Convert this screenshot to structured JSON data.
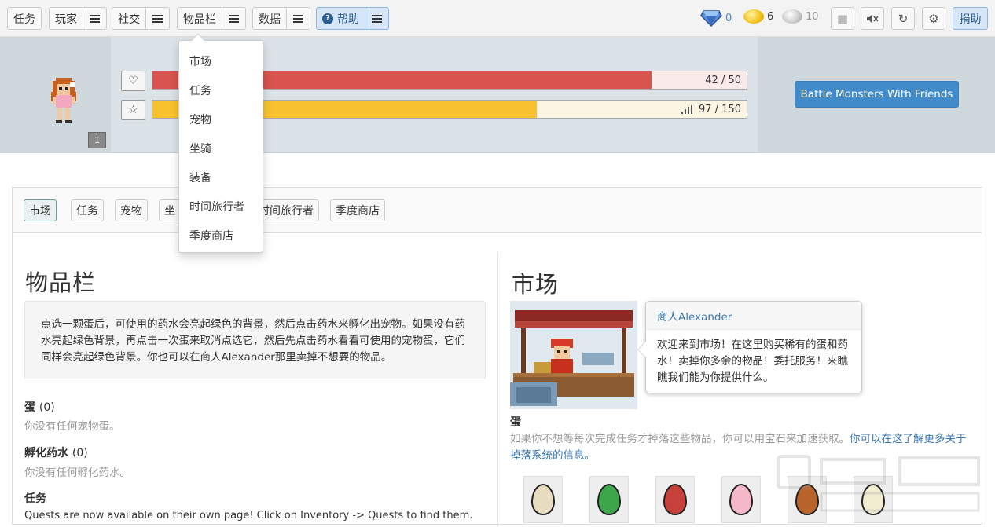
{
  "nav": {
    "tasks": "任务",
    "player": "玩家",
    "social": "社交",
    "inventory": "物品栏",
    "data": "数据",
    "help": "帮助"
  },
  "currency": {
    "gems": "0",
    "gold": "6",
    "silver": "10"
  },
  "donate": "捐助",
  "dropdown": {
    "items": [
      "市场",
      "任务",
      "宠物",
      "坐骑",
      "装备",
      "时间旅行者",
      "季度商店"
    ]
  },
  "stats": {
    "hp_text": "42 / 50",
    "hp_fraction": 0.84,
    "xp_text": "97 / 150",
    "xp_fraction": 0.647,
    "level": "1"
  },
  "battle_button": "Battle Monsters With Friends",
  "tabs": [
    "市场",
    "任务",
    "宠物",
    "坐",
    "时间旅行者",
    "季度商店"
  ],
  "left": {
    "title": "物品栏",
    "info": "点选一颗蛋后，可使用的药水会亮起绿色的背景，然后点击药水来孵化出宠物。如果没有药水亮起绿色背景，再点击一次蛋来取消点选它，然后先点击药水看看可使用的宠物蛋，它们同样会亮起绿色背景。你也可以在商人Alexander那里卖掉不想要的物品。",
    "eggs_title": "蛋",
    "eggs_count": "(0)",
    "eggs_empty": "你没有任何宠物蛋。",
    "potions_title": "孵化药水",
    "potions_count": "(0)",
    "potions_empty": "你没有任何孵化药水。",
    "quests_title": "任务",
    "quests_text": "Quests are now available on their own page! Click on Inventory -> Quests to find them."
  },
  "right": {
    "title": "市场",
    "npc_name": "商人Alexander",
    "npc_text": "欢迎来到市场！在这里购买稀有的蛋和药水！卖掉你多余的物品！委托服务！来瞧瞧我们能为你提供什么。",
    "eggs_label": "蛋",
    "eggs_desc": "如果你不想等每次完成任务才掉落这些物品，你可以用宝石来加速获取。",
    "eggs_link": "你可以在这了解更多关于掉落系统的信息。"
  },
  "egg_colors": [
    "#e8dcc0",
    "#3ea64a",
    "#c8403a",
    "#f4b8c8",
    "#b8642a",
    "#f2ecd0"
  ],
  "colors": {
    "hp": "#d9534f",
    "xp": "#f7c22d",
    "primary": "#428bca"
  }
}
